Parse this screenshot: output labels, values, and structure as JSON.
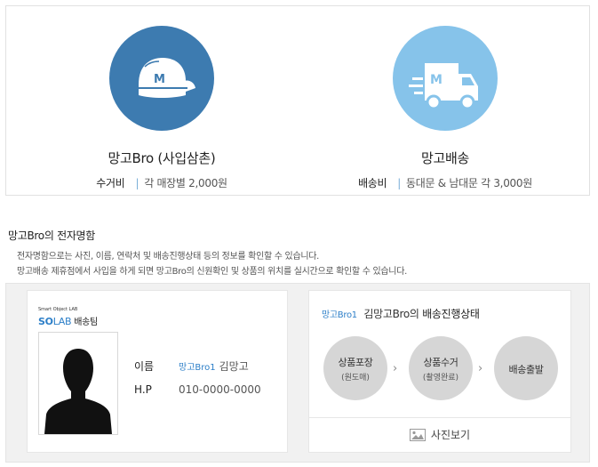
{
  "services": [
    {
      "title": "망고Bro (사입삼촌)",
      "fee_label": "수거비",
      "fee_detail": "각 매장별 2,000원",
      "icon": "cap-icon",
      "color": "#3d7bb0"
    },
    {
      "title": "망고배송",
      "fee_label": "배송비",
      "fee_detail": "동대문 & 남대문 각 3,000원",
      "icon": "truck-icon",
      "color": "#86c3ea"
    }
  ],
  "card_section": {
    "title": "망고Bro의 전자명함",
    "desc1": "전자명함으로는 사진, 이름, 연락처 및 배송진행상태 등의 정보를 확인할 수 있습니다.",
    "desc2": "망고배송 제휴점에서 사입을 하게 되면 망고Bro의 신원확인 및 상품의 위치를 실시간으로 확인할 수 있습니다."
  },
  "business_card": {
    "brand_small": "Smart Object LAB",
    "brand_so": "SO",
    "brand_lab": "LAB",
    "brand_team": "배송팀",
    "name_label": "이름",
    "name_badge": "망고Bro1",
    "name_value": "김망고",
    "phone_label": "H.P",
    "phone_value": "010-0000-0000"
  },
  "status": {
    "badge": "망고Bro1",
    "title_name": "김망고Bro의",
    "title_bold": "배송진행상태",
    "steps": [
      {
        "main": "상품포장",
        "sub": "(원도매)"
      },
      {
        "main": "상품수거",
        "sub": "(촬영완료)"
      },
      {
        "main": "배송출발",
        "sub": ""
      }
    ],
    "photo_button": "사진보기"
  },
  "colors": {
    "accent_blue": "#2d7fc8",
    "circle_dark": "#3d7bb0",
    "circle_light": "#86c3ea",
    "step_gray": "#d6d6d6"
  }
}
